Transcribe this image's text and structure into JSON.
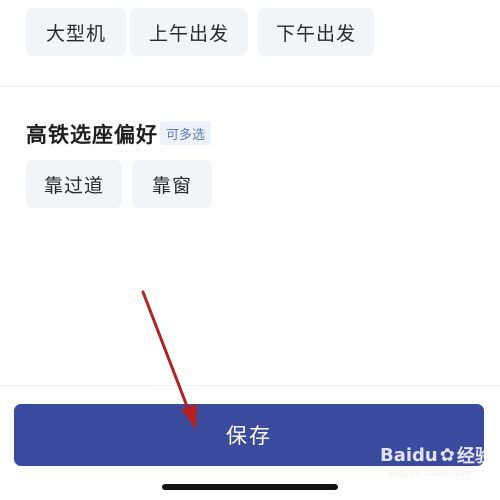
{
  "flight_preferences": {
    "chips": [
      "大型机",
      "上午出发",
      "下午出发"
    ]
  },
  "rail_seat": {
    "title": "高铁选座偏好",
    "tag": "可多选",
    "chips": [
      "靠过道",
      "靠窗"
    ]
  },
  "footer": {
    "save_label": "保存"
  },
  "watermark": {
    "brand": "Baidu",
    "suffix": "经验",
    "url": "jingyan.baidu.com"
  },
  "colors": {
    "primary_button": "#3a4a9c",
    "chip_bg": "#f3f4f6",
    "tag_text": "#5c7cc4",
    "annotation_arrow": "#b22222"
  }
}
